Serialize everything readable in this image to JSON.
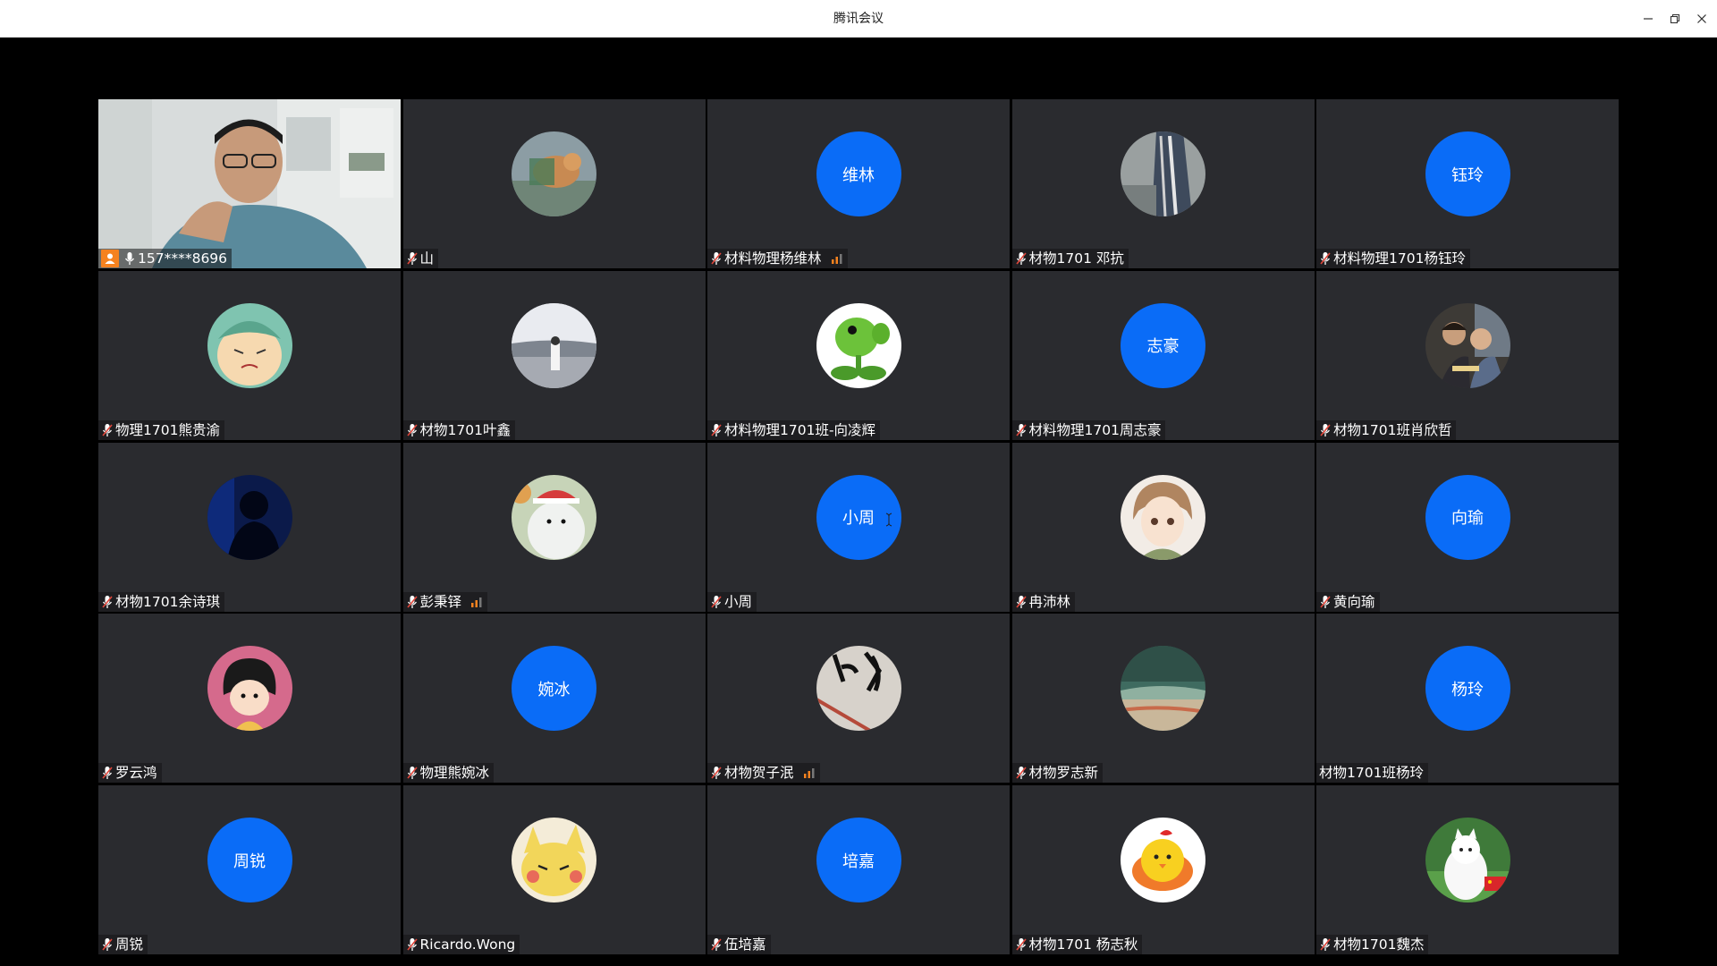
{
  "window": {
    "title": "腾讯会议"
  },
  "tiles": [
    {
      "name": "157****8696",
      "avatar": "video",
      "mic": "mic-on-icon",
      "host": true
    },
    {
      "name": "山",
      "avatar": "photo-dog"
    },
    {
      "name": "材料物理杨维林",
      "avatar_text": "维林",
      "signal": true
    },
    {
      "name": "材物1701 邓抗",
      "avatar": "photo-gray"
    },
    {
      "name": "材料物理1701杨钰玲",
      "avatar_text": "钰玲"
    },
    {
      "name": "物理1701熊贵渝",
      "avatar": "photo-cartoon-boy"
    },
    {
      "name": "材物1701叶鑫",
      "avatar": "photo-lake"
    },
    {
      "name": "材料物理1701班-向凌辉",
      "avatar": "photo-peashooter"
    },
    {
      "name": "材料物理1701周志豪",
      "avatar_text": "志豪"
    },
    {
      "name": "材物1701班肖欣哲",
      "avatar": "photo-couple"
    },
    {
      "name": "材物1701余诗琪",
      "avatar": "photo-silhouette"
    },
    {
      "name": "彭秉铎",
      "avatar": "photo-bear",
      "signal": true
    },
    {
      "name": "小周",
      "avatar_text": "小周"
    },
    {
      "name": "冉沛林",
      "avatar": "photo-anime-boy"
    },
    {
      "name": "黄向瑜",
      "avatar_text": "向瑜"
    },
    {
      "name": "罗云鸿",
      "avatar": "photo-maruko"
    },
    {
      "name": "物理熊婉冰",
      "avatar_text": "婉冰"
    },
    {
      "name": "材物贺子泯",
      "avatar": "photo-calligraphy",
      "signal": true
    },
    {
      "name": "材物罗志新",
      "avatar": "photo-beach"
    },
    {
      "name": "材物1701班杨玲",
      "avatar_text": "杨玲",
      "no_mic": true
    },
    {
      "name": "周锐",
      "avatar_text": "周锐"
    },
    {
      "name": "Ricardo.Wong",
      "avatar": "photo-pikachu"
    },
    {
      "name": "伍培嘉",
      "avatar_text": "培嘉"
    },
    {
      "name": "材物1701 杨志秋",
      "avatar": "photo-chick"
    },
    {
      "name": "材物1701魏杰",
      "avatar": "photo-samoyed"
    }
  ],
  "colors": {
    "avatar_blue": "#0a6cf7",
    "tile_bg": "#2a2b2f",
    "host_orange": "#f5821f",
    "signal_orange": "#f5821f"
  }
}
